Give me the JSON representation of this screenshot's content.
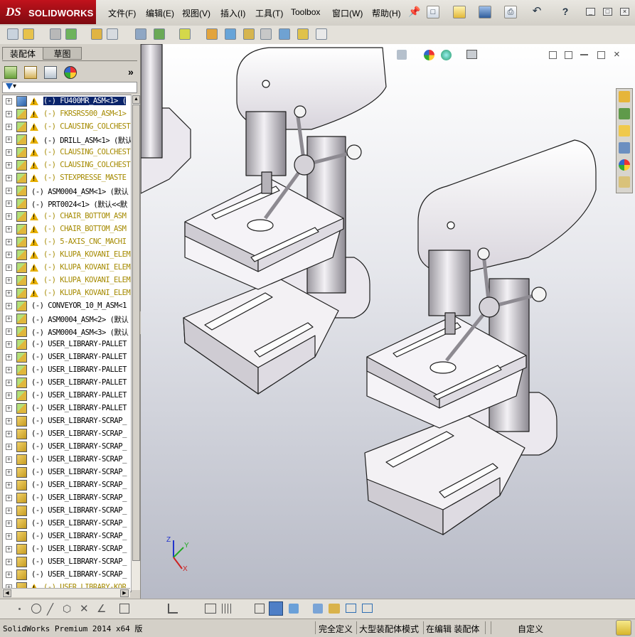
{
  "app": {
    "logo_ds": "DS",
    "logo_text": "SOLIDWORKS"
  },
  "menu": [
    "文件(F)",
    "编辑(E)",
    "视图(V)",
    "插入(I)",
    "工具(T)",
    "Toolbox",
    "窗口(W)",
    "帮助(H)"
  ],
  "panel": {
    "tabs": [
      "装配体",
      "草图"
    ],
    "more": "»",
    "filter_arrow": "▾"
  },
  "tree": [
    {
      "label": "(-) FU400MR_ASM<1> (",
      "warn": true,
      "color": "sel"
    },
    {
      "label": "(-) FKRSRS500_ASM<1>",
      "warn": true,
      "color": "yellow"
    },
    {
      "label": "(-) CLAUSING_COLCHEST",
      "warn": true,
      "color": "yellow"
    },
    {
      "label": "(-) DRILL_ASM<1> (默认<",
      "warn": true,
      "color": "black"
    },
    {
      "label": "(-) CLAUSING_COLCHEST",
      "warn": true,
      "color": "yellow"
    },
    {
      "label": "(-) CLAUSING_COLCHEST",
      "warn": true,
      "color": "yellow"
    },
    {
      "label": "(-) STEXPRESSE_MASTE",
      "warn": true,
      "color": "yellow"
    },
    {
      "label": "(-) ASM0004_ASM<1> (默认",
      "warn": false,
      "color": "black"
    },
    {
      "label": "(-) PRT0024<1> (默认<<默",
      "warn": false,
      "color": "black"
    },
    {
      "label": "(-) CHAIR_BOTTOM_ASM",
      "warn": true,
      "color": "yellow"
    },
    {
      "label": "(-) CHAIR_BOTTOM_ASM",
      "warn": true,
      "color": "yellow"
    },
    {
      "label": "(-) 5-AXIS_CNC_MACHI",
      "warn": true,
      "color": "yellow"
    },
    {
      "label": "(-) KLUPA_KOVANI_ELEM",
      "warn": true,
      "color": "yellow"
    },
    {
      "label": "(-) KLUPA_KOVANI_ELEM",
      "warn": true,
      "color": "yellow"
    },
    {
      "label": "(-) KLUPA_KOVANI_ELEM",
      "warn": true,
      "color": "yellow"
    },
    {
      "label": "(-) KLUPA_KOVANI_ELEM",
      "warn": true,
      "color": "yellow"
    },
    {
      "label": "(-) CONVEYOR_10_M_ASM<1",
      "warn": false,
      "color": "black"
    },
    {
      "label": "(-) ASM0004_ASM<2> (默认",
      "warn": false,
      "color": "black"
    },
    {
      "label": "(-) ASM0004_ASM<3> (默认",
      "warn": false,
      "color": "black"
    },
    {
      "label": "(-) USER_LIBRARY-PALLET",
      "warn": false,
      "color": "black"
    },
    {
      "label": "(-) USER_LIBRARY-PALLET",
      "warn": false,
      "color": "black"
    },
    {
      "label": "(-) USER_LIBRARY-PALLET",
      "warn": false,
      "color": "black"
    },
    {
      "label": "(-) USER_LIBRARY-PALLET",
      "warn": false,
      "color": "black"
    },
    {
      "label": "(-) USER_LIBRARY-PALLET",
      "warn": false,
      "color": "black"
    },
    {
      "label": "(-) USER_LIBRARY-PALLET",
      "warn": false,
      "color": "black"
    },
    {
      "label": "(-) USER_LIBRARY-SCRAP_",
      "warn": false,
      "color": "black"
    },
    {
      "label": "(-) USER_LIBRARY-SCRAP_",
      "warn": false,
      "color": "black"
    },
    {
      "label": "(-) USER_LIBRARY-SCRAP_",
      "warn": false,
      "color": "black"
    },
    {
      "label": "(-) USER_LIBRARY-SCRAP_",
      "warn": false,
      "color": "black"
    },
    {
      "label": "(-) USER_LIBRARY-SCRAP_",
      "warn": false,
      "color": "black"
    },
    {
      "label": "(-) USER_LIBRARY-SCRAP_",
      "warn": false,
      "color": "black"
    },
    {
      "label": "(-) USER_LIBRARY-SCRAP_",
      "warn": false,
      "color": "black"
    },
    {
      "label": "(-) USER_LIBRARY-SCRAP_",
      "warn": false,
      "color": "black"
    },
    {
      "label": "(-) USER_LIBRARY-SCRAP_",
      "warn": false,
      "color": "black"
    },
    {
      "label": "(-) USER_LIBRARY-SCRAP_",
      "warn": false,
      "color": "black"
    },
    {
      "label": "(-) USER_LIBRARY-SCRAP_",
      "warn": false,
      "color": "black"
    },
    {
      "label": "(-) USER_LIBRARY-SCRAP_",
      "warn": false,
      "color": "black"
    },
    {
      "label": "(-) USER_LIBRARY-SCRAP_",
      "warn": false,
      "color": "black"
    },
    {
      "label": "(-) USER_LIBRARY-KOR",
      "warn": true,
      "color": "yellow"
    }
  ],
  "triad": {
    "x": "X",
    "y": "Y",
    "z": "Z"
  },
  "status": {
    "product": "SolidWorks Premium 2014 x64 版",
    "defined": "完全定义",
    "mode": "大型装配体模式",
    "editing": "在编辑 装配体",
    "custom": "自定义"
  },
  "colors": {
    "brand": "#b20f18",
    "selection": "#0a246a",
    "warning_text": "#a58a00",
    "viewport_top": "#ffffff",
    "viewport_bottom": "#b7bac6"
  },
  "icons": {
    "topbar": [
      "new-document-icon",
      "open-icon",
      "save-icon",
      "print-icon",
      "undo-icon",
      "help-icon"
    ],
    "viewport": [
      "zoom-to-fit-icon",
      "zoom-area-icon",
      "previous-view-icon",
      "section-view-icon",
      "view-orientation-icon",
      "display-style-icon",
      "hide-show-icon",
      "appearance-icon",
      "scene-icon",
      "view-settings-icon"
    ],
    "taskpane": [
      "home-icon",
      "resources-icon",
      "folder-icon",
      "library-icon",
      "appearance-icon",
      "properties-icon"
    ]
  }
}
